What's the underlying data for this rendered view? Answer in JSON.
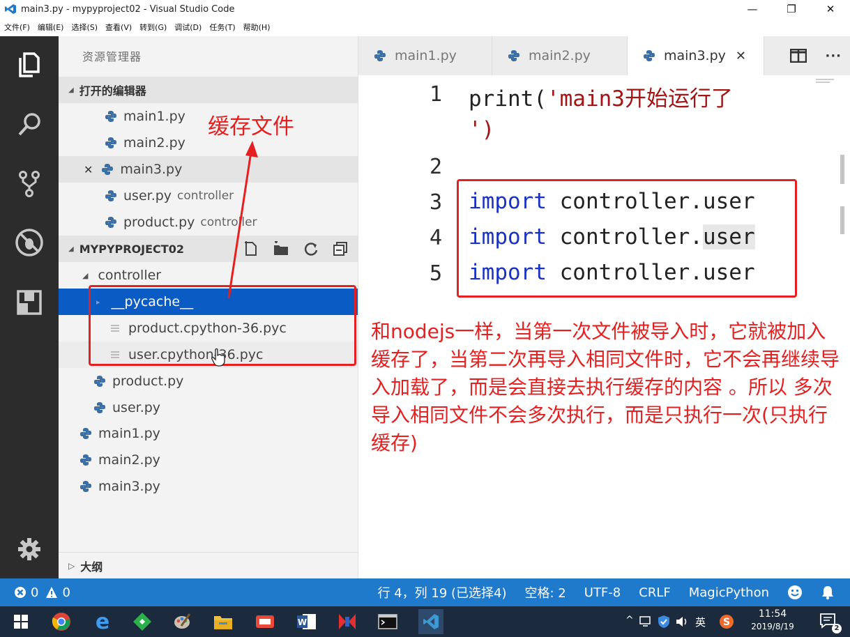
{
  "window": {
    "title": "main3.py - mypyproject02 - Visual Studio Code",
    "minimize_glyph": "—",
    "maximize_glyph": "❐",
    "close_glyph": "✕"
  },
  "menu": [
    "文件(F)",
    "编辑(E)",
    "选择(S)",
    "查看(V)",
    "转到(G)",
    "调试(D)",
    "任务(T)",
    "帮助(H)"
  ],
  "activity": {
    "icons": [
      "explorer-icon",
      "search-icon",
      "source-control-icon",
      "debug-icon",
      "extensions-icon",
      "settings-gear-icon"
    ]
  },
  "sidebar": {
    "title": "资源管理器",
    "open_editors": {
      "label": "打开的编辑器",
      "items": [
        {
          "name": "main1.py",
          "desc": ""
        },
        {
          "name": "main2.py",
          "desc": ""
        },
        {
          "name": "main3.py",
          "desc": "",
          "close": "✕"
        },
        {
          "name": "user.py",
          "desc": "controller"
        },
        {
          "name": "product.py",
          "desc": "controller"
        }
      ]
    },
    "project": {
      "label": "MYPYPROJECT02",
      "tree": [
        {
          "name": "controller",
          "kind": "folder"
        },
        {
          "name": "__pycache__",
          "kind": "folder"
        },
        {
          "name": "product.cpython-36.pyc",
          "kind": "file"
        },
        {
          "name": "user.cpython-36.pyc",
          "kind": "file"
        },
        {
          "name": "product.py",
          "kind": "py"
        },
        {
          "name": "user.py",
          "kind": "py"
        },
        {
          "name": "main1.py",
          "kind": "py"
        },
        {
          "name": "main2.py",
          "kind": "py"
        },
        {
          "name": "main3.py",
          "kind": "py"
        }
      ]
    },
    "outline": {
      "label": "大纲"
    }
  },
  "tabs": [
    {
      "label": "main1.py",
      "active": false
    },
    {
      "label": "main2.py",
      "active": false
    },
    {
      "label": "main3.py",
      "active": true,
      "close": "✕"
    }
  ],
  "editor": {
    "lines": [
      {
        "num": "1",
        "parts": [
          {
            "t": "print(",
            "c": ""
          },
          {
            "t": "'main3开始运行了",
            "c": "str"
          }
        ]
      },
      {
        "num": "",
        "parts": [
          {
            "t": "')",
            "c": ""
          }
        ]
      },
      {
        "num": "2",
        "parts": []
      },
      {
        "num": "3",
        "parts": [
          {
            "t": "import",
            "c": "kw"
          },
          {
            "t": " controller.user",
            "c": ""
          }
        ]
      },
      {
        "num": "4",
        "parts": [
          {
            "t": "import",
            "c": "kw"
          },
          {
            "t": " controller.",
            "c": ""
          },
          {
            "t": "user",
            "c": "hl"
          }
        ]
      },
      {
        "num": "5",
        "parts": [
          {
            "t": "import",
            "c": "kw"
          },
          {
            "t": " controller.user",
            "c": ""
          }
        ]
      }
    ]
  },
  "annotations": {
    "cache_label": "缓存文件",
    "note": "和nodejs一样，当第一次文件被导入时，它就被加入缓存了，当第二次再导入相同文件时，它不会再继续导入加载了，而是会直接去执行缓存的内容 。所以 多次导入相同文件不会多次执行，而是只执行一次(只执行缓存)"
  },
  "statusbar": {
    "errors": "0",
    "warnings": "0",
    "position": "行 4，列 19 (已选择4)",
    "spaces": "空格: 2",
    "encoding": "UTF-8",
    "eol": "CRLF",
    "language": "MagicPython"
  },
  "taskbar": {
    "time": "11:54",
    "date": "2019/8/19",
    "ime": "英",
    "notification_count": "2"
  },
  "colors": {
    "statusbar": "#1f7acc",
    "selection": "#0a5bc4",
    "annotation": "#e52020",
    "keyword": "#1a32c2",
    "string": "#a31515"
  }
}
